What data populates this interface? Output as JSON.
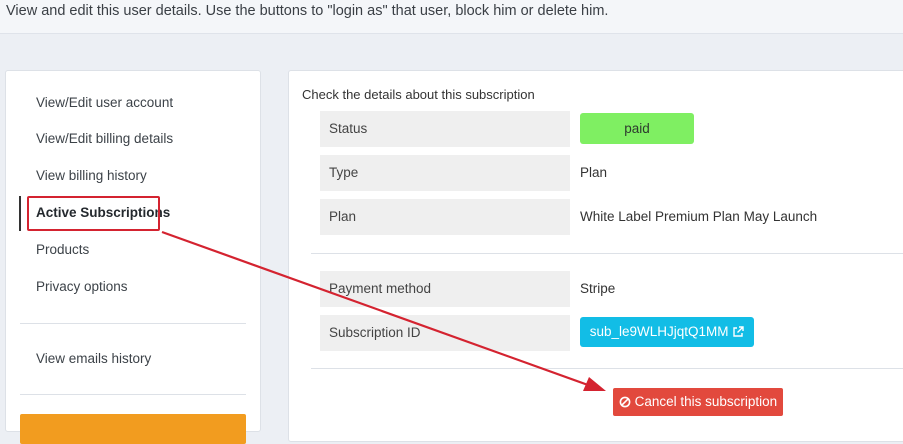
{
  "header": {
    "description": "View and edit this user details. Use the buttons to \"login as\" that user, block him or delete him."
  },
  "sidebar": {
    "items": [
      {
        "label": "View/Edit user account"
      },
      {
        "label": "View/Edit billing details"
      },
      {
        "label": "View billing history"
      },
      {
        "label": "Active Subscriptions",
        "active": true
      },
      {
        "label": "Products"
      },
      {
        "label": "Privacy options"
      },
      {
        "label": "View emails history"
      }
    ]
  },
  "subscription": {
    "intro": "Check the details about this subscription",
    "status_label": "Status",
    "status_value": "paid",
    "type_label": "Type",
    "type_value": "Plan",
    "plan_label": "Plan",
    "plan_value": "White Label Premium Plan May Launch",
    "payment_label": "Payment method",
    "payment_value": "Stripe",
    "subid_label": "Subscription ID",
    "subid_value": "sub_le9WLHJjqtQ1MM",
    "cancel_label": "Cancel this subscription"
  },
  "colors": {
    "paid_badge": "#7fef62",
    "subscription_link": "#12bde6",
    "cancel_button": "#e2493d",
    "annotation": "#d42330",
    "orange_button": "#f29c1f"
  },
  "icons": {
    "subscription_link": "external-link-icon",
    "cancel": "ban-icon"
  }
}
